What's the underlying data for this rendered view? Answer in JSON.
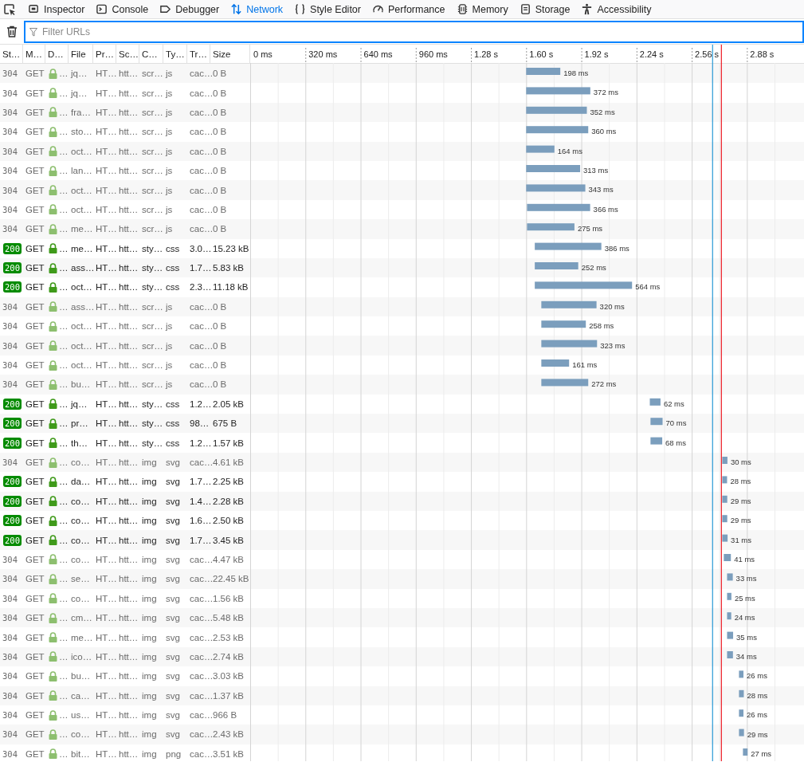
{
  "toolbar": {
    "tabs": [
      {
        "label": "Inspector",
        "selected": false
      },
      {
        "label": "Console",
        "selected": false
      },
      {
        "label": "Debugger",
        "selected": false
      },
      {
        "label": "Network",
        "selected": true
      },
      {
        "label": "Style Editor",
        "selected": false
      },
      {
        "label": "Performance",
        "selected": false
      },
      {
        "label": "Memory",
        "selected": false
      },
      {
        "label": "Storage",
        "selected": false
      },
      {
        "label": "Accessibility",
        "selected": false
      }
    ]
  },
  "filter": {
    "placeholder": "Filter URLs"
  },
  "table": {
    "columns": [
      "St…",
      "M…",
      "D…",
      "File",
      "Pr…",
      "Sc…",
      "C…",
      "Ty…",
      "Tr…",
      "Size"
    ],
    "rows": [
      {
        "cells": [
          "304",
          "GET",
          "…",
          "jq…",
          "HT…",
          "htt…",
          "scr…",
          "js",
          "cac…",
          "0 B"
        ],
        "cached": true
      },
      {
        "cells": [
          "304",
          "GET",
          "…",
          "jq…",
          "HT…",
          "htt…",
          "scr…",
          "js",
          "cac…",
          "0 B"
        ],
        "cached": true
      },
      {
        "cells": [
          "304",
          "GET",
          "…",
          "fra…",
          "HT…",
          "htt…",
          "scr…",
          "js",
          "cac…",
          "0 B"
        ],
        "cached": true
      },
      {
        "cells": [
          "304",
          "GET",
          "…",
          "sto…",
          "HT…",
          "htt…",
          "scr…",
          "js",
          "cac…",
          "0 B"
        ],
        "cached": true
      },
      {
        "cells": [
          "304",
          "GET",
          "…",
          "oct…",
          "HT…",
          "htt…",
          "scr…",
          "js",
          "cac…",
          "0 B"
        ],
        "cached": true
      },
      {
        "cells": [
          "304",
          "GET",
          "…",
          "lan…",
          "HT…",
          "htt…",
          "scr…",
          "js",
          "cac…",
          "0 B"
        ],
        "cached": true
      },
      {
        "cells": [
          "304",
          "GET",
          "…",
          "oct…",
          "HT…",
          "htt…",
          "scr…",
          "js",
          "cac…",
          "0 B"
        ],
        "cached": true
      },
      {
        "cells": [
          "304",
          "GET",
          "…",
          "oct…",
          "HT…",
          "htt…",
          "scr…",
          "js",
          "cac…",
          "0 B"
        ],
        "cached": true
      },
      {
        "cells": [
          "304",
          "GET",
          "…",
          "me…",
          "HT…",
          "htt…",
          "scr…",
          "js",
          "cac…",
          "0 B"
        ],
        "cached": true
      },
      {
        "cells": [
          "200",
          "GET",
          "…",
          "me…",
          "HT…",
          "htt…",
          "sty…",
          "css",
          "3.0…",
          "15.23 kB"
        ],
        "cached": false
      },
      {
        "cells": [
          "200",
          "GET",
          "…",
          "ass…",
          "HT…",
          "htt…",
          "sty…",
          "css",
          "1.7…",
          "5.83 kB"
        ],
        "cached": false
      },
      {
        "cells": [
          "200",
          "GET",
          "…",
          "oct…",
          "HT…",
          "htt…",
          "sty…",
          "css",
          "2.3…",
          "11.18 kB"
        ],
        "cached": false
      },
      {
        "cells": [
          "304",
          "GET",
          "…",
          "ass…",
          "HT…",
          "htt…",
          "scr…",
          "js",
          "cac…",
          "0 B"
        ],
        "cached": true
      },
      {
        "cells": [
          "304",
          "GET",
          "…",
          "oct…",
          "HT…",
          "htt…",
          "scr…",
          "js",
          "cac…",
          "0 B"
        ],
        "cached": true
      },
      {
        "cells": [
          "304",
          "GET",
          "…",
          "oct…",
          "HT…",
          "htt…",
          "scr…",
          "js",
          "cac…",
          "0 B"
        ],
        "cached": true
      },
      {
        "cells": [
          "304",
          "GET",
          "…",
          "oct…",
          "HT…",
          "htt…",
          "scr…",
          "js",
          "cac…",
          "0 B"
        ],
        "cached": true
      },
      {
        "cells": [
          "304",
          "GET",
          "…",
          "bu…",
          "HT…",
          "htt…",
          "scr…",
          "js",
          "cac…",
          "0 B"
        ],
        "cached": true
      },
      {
        "cells": [
          "200",
          "GET",
          "…",
          "jq…",
          "HT…",
          "htt…",
          "sty…",
          "css",
          "1.2…",
          "2.05 kB"
        ],
        "cached": false
      },
      {
        "cells": [
          "200",
          "GET",
          "…",
          "pr…",
          "HT…",
          "htt…",
          "sty…",
          "css",
          "98…",
          "675 B"
        ],
        "cached": false
      },
      {
        "cells": [
          "200",
          "GET",
          "…",
          "th…",
          "HT…",
          "htt…",
          "sty…",
          "css",
          "1.2…",
          "1.57 kB"
        ],
        "cached": false
      },
      {
        "cells": [
          "304",
          "GET",
          "…",
          "co…",
          "HT…",
          "htt…",
          "img",
          "svg",
          "cac…",
          "4.61 kB"
        ],
        "cached": true
      },
      {
        "cells": [
          "200",
          "GET",
          "…",
          "da…",
          "HT…",
          "htt…",
          "img",
          "svg",
          "1.7…",
          "2.25 kB"
        ],
        "cached": false
      },
      {
        "cells": [
          "200",
          "GET",
          "…",
          "co…",
          "HT…",
          "htt…",
          "img",
          "svg",
          "1.4…",
          "2.28 kB"
        ],
        "cached": false
      },
      {
        "cells": [
          "200",
          "GET",
          "…",
          "co…",
          "HT…",
          "htt…",
          "img",
          "svg",
          "1.6…",
          "2.50 kB"
        ],
        "cached": false
      },
      {
        "cells": [
          "200",
          "GET",
          "…",
          "co…",
          "HT…",
          "htt…",
          "img",
          "svg",
          "1.7…",
          "3.45 kB"
        ],
        "cached": false
      },
      {
        "cells": [
          "304",
          "GET",
          "…",
          "co…",
          "HT…",
          "htt…",
          "img",
          "svg",
          "cac…",
          "4.47 kB"
        ],
        "cached": true
      },
      {
        "cells": [
          "304",
          "GET",
          "…",
          "se…",
          "HT…",
          "htt…",
          "img",
          "svg",
          "cac…",
          "22.45 kB"
        ],
        "cached": true
      },
      {
        "cells": [
          "304",
          "GET",
          "…",
          "co…",
          "HT…",
          "htt…",
          "img",
          "svg",
          "cac…",
          "1.56 kB"
        ],
        "cached": true
      },
      {
        "cells": [
          "304",
          "GET",
          "…",
          "cm…",
          "HT…",
          "htt…",
          "img",
          "svg",
          "cac…",
          "5.48 kB"
        ],
        "cached": true
      },
      {
        "cells": [
          "304",
          "GET",
          "…",
          "me…",
          "HT…",
          "htt…",
          "img",
          "svg",
          "cac…",
          "2.53 kB"
        ],
        "cached": true
      },
      {
        "cells": [
          "304",
          "GET",
          "…",
          "ico…",
          "HT…",
          "htt…",
          "img",
          "svg",
          "cac…",
          "2.74 kB"
        ],
        "cached": true
      },
      {
        "cells": [
          "304",
          "GET",
          "…",
          "bu…",
          "HT…",
          "htt…",
          "img",
          "svg",
          "cac…",
          "3.03 kB"
        ],
        "cached": true
      },
      {
        "cells": [
          "304",
          "GET",
          "…",
          "ca…",
          "HT…",
          "htt…",
          "img",
          "svg",
          "cac…",
          "1.37 kB"
        ],
        "cached": true
      },
      {
        "cells": [
          "304",
          "GET",
          "…",
          "us…",
          "HT…",
          "htt…",
          "img",
          "svg",
          "cac…",
          "966 B"
        ],
        "cached": true
      },
      {
        "cells": [
          "304",
          "GET",
          "…",
          "co…",
          "HT…",
          "htt…",
          "img",
          "svg",
          "cac…",
          "2.43 kB"
        ],
        "cached": true
      },
      {
        "cells": [
          "304",
          "GET",
          "…",
          "bit…",
          "HT…",
          "htt…",
          "img",
          "png",
          "cac…",
          "3.51 kB"
        ],
        "cached": true
      }
    ],
    "timeline": {
      "ticks": [
        "0 ms",
        "320 ms",
        "640 ms",
        "960 ms",
        "1.28 s",
        "1.60 s",
        "1.92 s",
        "2.24 s",
        "2.56 s",
        "2.88 s"
      ],
      "timings": [
        "198 ms",
        "372 ms",
        "352 ms",
        "360 ms",
        "164 ms",
        "313 ms",
        "343 ms",
        "366 ms",
        "275 ms",
        "386 ms",
        "252 ms",
        "564 ms",
        "320 ms",
        "258 ms",
        "323 ms",
        "161 ms",
        "272 ms",
        "62 ms",
        "70 ms",
        "68 ms",
        "30 ms",
        "28 ms",
        "29 ms",
        "29 ms",
        "31 ms",
        "41 ms",
        "33 ms",
        "25 ms",
        "24 ms",
        "35 ms",
        "34 ms",
        "26 ms",
        "28 ms",
        "26 ms",
        "29 ms",
        "27 ms"
      ]
    }
  }
}
